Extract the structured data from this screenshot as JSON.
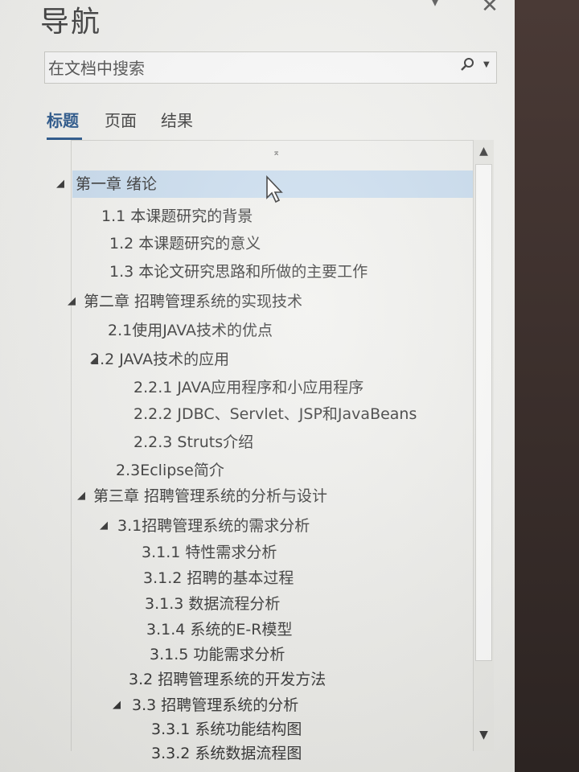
{
  "pane": {
    "title": "导航",
    "options_icon": "triangle-down-icon",
    "close_icon": "close-x-icon"
  },
  "search": {
    "placeholder": "在文档中搜索",
    "search_icon": "magnifier-icon",
    "dropdown_icon": "chevron-down-icon"
  },
  "tabs": [
    {
      "label": "标题",
      "active": true
    },
    {
      "label": "页面",
      "active": false
    },
    {
      "label": "结果",
      "active": false
    }
  ],
  "headings": [
    {
      "text": "第一章  绪论",
      "level": 1,
      "expanded": true,
      "selected": true
    },
    {
      "text": "1.1  本课题研究的背景",
      "level": 2
    },
    {
      "text": "1.2  本课题研究的意义",
      "level": 2
    },
    {
      "text": "1.3  本论文研究思路和所做的主要工作",
      "level": 2
    },
    {
      "text": "第二章  招聘管理系统的实现技术",
      "level": 1,
      "expanded": true
    },
    {
      "text": "2.1使用JAVA技术的优点",
      "level": 2
    },
    {
      "text": "2.2 JAVA技术的应用",
      "level": 2,
      "expanded": true
    },
    {
      "text": "2.2.1 JAVA应用程序和小应用程序",
      "level": 3
    },
    {
      "text": "2.2.2 JDBC、Servlet、JSP和JavaBeans",
      "level": 3
    },
    {
      "text": "2.2.3 Struts介绍",
      "level": 3
    },
    {
      "text": "2.3Eclipse简介",
      "level": 2
    },
    {
      "text": "第三章  招聘管理系统的分析与设计",
      "level": 1,
      "expanded": true
    },
    {
      "text": "3.1招聘管理系统的需求分析",
      "level": 2,
      "expanded": true
    },
    {
      "text": "3.1.1 特性需求分析",
      "level": 3
    },
    {
      "text": "3.1.2 招聘的基本过程",
      "level": 3
    },
    {
      "text": "3.1.3 数据流程分析",
      "level": 3
    },
    {
      "text": "3.1.4 系统的E-R模型",
      "level": 3
    },
    {
      "text": "3.1.5 功能需求分析",
      "level": 3
    },
    {
      "text": "3.2 招聘管理系统的开发方法",
      "level": 2
    },
    {
      "text": "3.3 招聘管理系统的分析",
      "level": 2,
      "expanded": true
    },
    {
      "text": "3.3.1 系统功能结构图",
      "level": 3
    },
    {
      "text": "3.3.2 系统数据流程图",
      "level": 3
    }
  ],
  "scrollbar": {
    "up_icon": "scroll-up-arrow-icon",
    "down_icon": "scroll-down-arrow-icon"
  },
  "colors": {
    "selected_row": "#c7dbee",
    "active_tab": "#1f4f86"
  }
}
